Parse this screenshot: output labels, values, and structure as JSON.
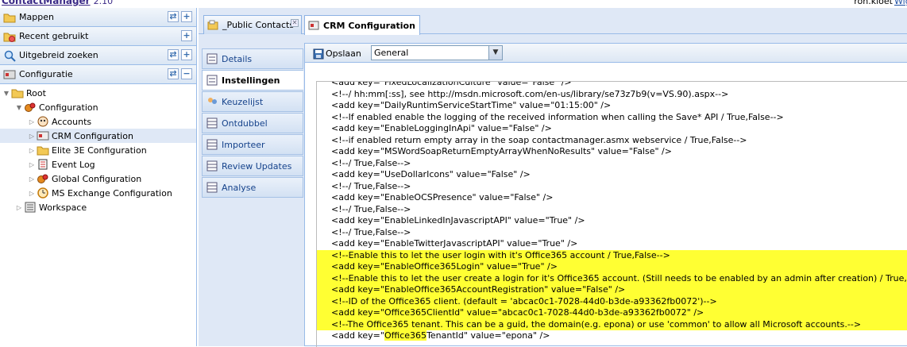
{
  "header": {
    "app_name": "ContactManager",
    "version": "2.10",
    "user": "ron.kloet",
    "user_link": "Wig"
  },
  "left": {
    "sections": [
      {
        "label": "Mappen",
        "icon": "folder-icon",
        "tools": [
          "refresh",
          "plus"
        ]
      },
      {
        "label": "Recent gebruikt",
        "icon": "recent-folder-icon",
        "tools": [
          "plus"
        ]
      },
      {
        "label": "Uitgebreid zoeken",
        "icon": "search-icon",
        "tools": [
          "refresh",
          "plus"
        ]
      },
      {
        "label": "Configuratie",
        "icon": "config-icon",
        "tools": [
          "refresh",
          "minus"
        ]
      }
    ],
    "tree": [
      {
        "label": "Root",
        "level": 0,
        "expanded": true
      },
      {
        "label": "Configuration",
        "level": 1,
        "expanded": true
      },
      {
        "label": "Accounts",
        "level": 2
      },
      {
        "label": "CRM Configuration",
        "level": 2,
        "selected": true
      },
      {
        "label": "Elite 3E Configuration",
        "level": 2
      },
      {
        "label": "Event Log",
        "level": 2
      },
      {
        "label": "Global Configuration",
        "level": 2
      },
      {
        "label": "MS Exchange Configuration",
        "level": 2
      },
      {
        "label": "Workspace",
        "level": 1
      }
    ]
  },
  "tabs": [
    {
      "label": "_Public Contacts",
      "active": false
    },
    {
      "label": "CRM Configuration",
      "active": true
    }
  ],
  "sidetabs": [
    {
      "label": "Details"
    },
    {
      "label": "Instellingen",
      "active": true
    },
    {
      "label": "Keuzelijst"
    },
    {
      "label": "Ontdubbel"
    },
    {
      "label": "Importeer"
    },
    {
      "label": "Review Updates"
    },
    {
      "label": "Analyse"
    }
  ],
  "toolbar": {
    "save_label": "Opslaan",
    "select_value": "General"
  },
  "editor": {
    "lines": [
      {
        "text": "<add key=\"FixedLocalizationCulture\" value=\"False\" />"
      },
      {
        "text": "<!--/ hh:mm[:ss], see http://msdn.microsoft.com/en-us/library/se73z7b9(v=VS.90).aspx-->"
      },
      {
        "text": "<add key=\"DailyRuntimServiceStartTime\" value=\"01:15:00\" />"
      },
      {
        "text": "<!--If enabled enable the logging of the received information when calling the Save* API / True,False-->"
      },
      {
        "text": "<add key=\"EnableLoggingInApi\" value=\"False\" />"
      },
      {
        "text": "<!--if enabled return empty array in the soap contactmanager.asmx webservice / True,False-->"
      },
      {
        "text": "<add key=\"MSWordSoapReturnEmptyArrayWhenNoResults\" value=\"False\" />"
      },
      {
        "text": "<!--/ True,False-->"
      },
      {
        "text": "<add key=\"UseDollarIcons\" value=\"False\" />"
      },
      {
        "text": "<!--/ True,False-->"
      },
      {
        "text": "<add key=\"EnableOCSPresence\" value=\"False\" />"
      },
      {
        "text": "<!--/ True,False-->"
      },
      {
        "text": "<add key=\"EnableLinkedInJavascriptAPI\" value=\"True\" />"
      },
      {
        "text": "<!--/ True,False-->"
      },
      {
        "text": "<add key=\"EnableTwitterJavascriptAPI\" value=\"True\" />"
      },
      {
        "text": "<!--Enable this to let the user login with it's Office365 account / True,False-->",
        "hl": true
      },
      {
        "text": "<add key=\"EnableOffice365Login\" value=\"True\" />",
        "hl": true
      },
      {
        "text": "<!--Enable this to let the user create a login for it's Office365 account. (Still needs to be enabled by an admin after creation) / True,False-->",
        "hl": true
      },
      {
        "text": "<add key=\"EnableOffice365AccountRegistration\" value=\"False\" />",
        "hl": true
      },
      {
        "text": "<!--ID of the Office365 client. (default = 'abcac0c1-7028-44d0-b3de-a93362fb0072')-->",
        "hl": true
      },
      {
        "text": "<add key=\"Office365ClientId\" value=\"abcac0c1-7028-44d0-b3de-a93362fb0072\" />",
        "hl": true
      },
      {
        "text": "<!--The Office365 tenant. This can be a guid, the domain(e.g. epona) or use 'common' to allow all Microsoft accounts.-->",
        "hl": true
      },
      {
        "text_pre": "<add key=\"",
        "text_hl": "Office365",
        "text_post": "TenantId\" value=\"epona\" />"
      }
    ]
  }
}
